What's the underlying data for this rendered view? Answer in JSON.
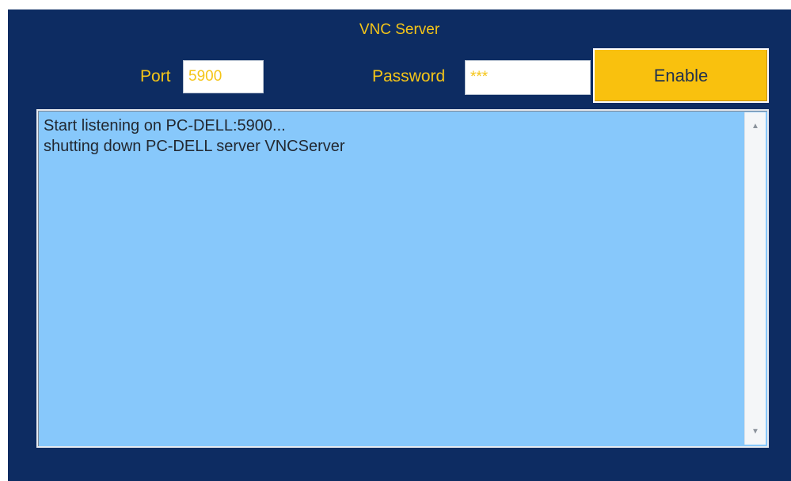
{
  "window": {
    "title": "VNC Server"
  },
  "form": {
    "port_label": "Port",
    "port_value": "5900",
    "password_label": "Password",
    "password_value": "***",
    "enable_label": "Enable"
  },
  "log": {
    "lines": [
      "Start listening on PC-DELL:5900...",
      "shutting down PC-DELL server VNCServer"
    ]
  },
  "colors": {
    "panel_background": "#0d2c62",
    "accent_text": "#f5c518",
    "button_background": "#f9c10e",
    "log_background": "#87c8fb"
  },
  "icons": {
    "scroll_up": "scroll-up-arrow-icon",
    "scroll_down": "scroll-down-arrow-icon"
  }
}
